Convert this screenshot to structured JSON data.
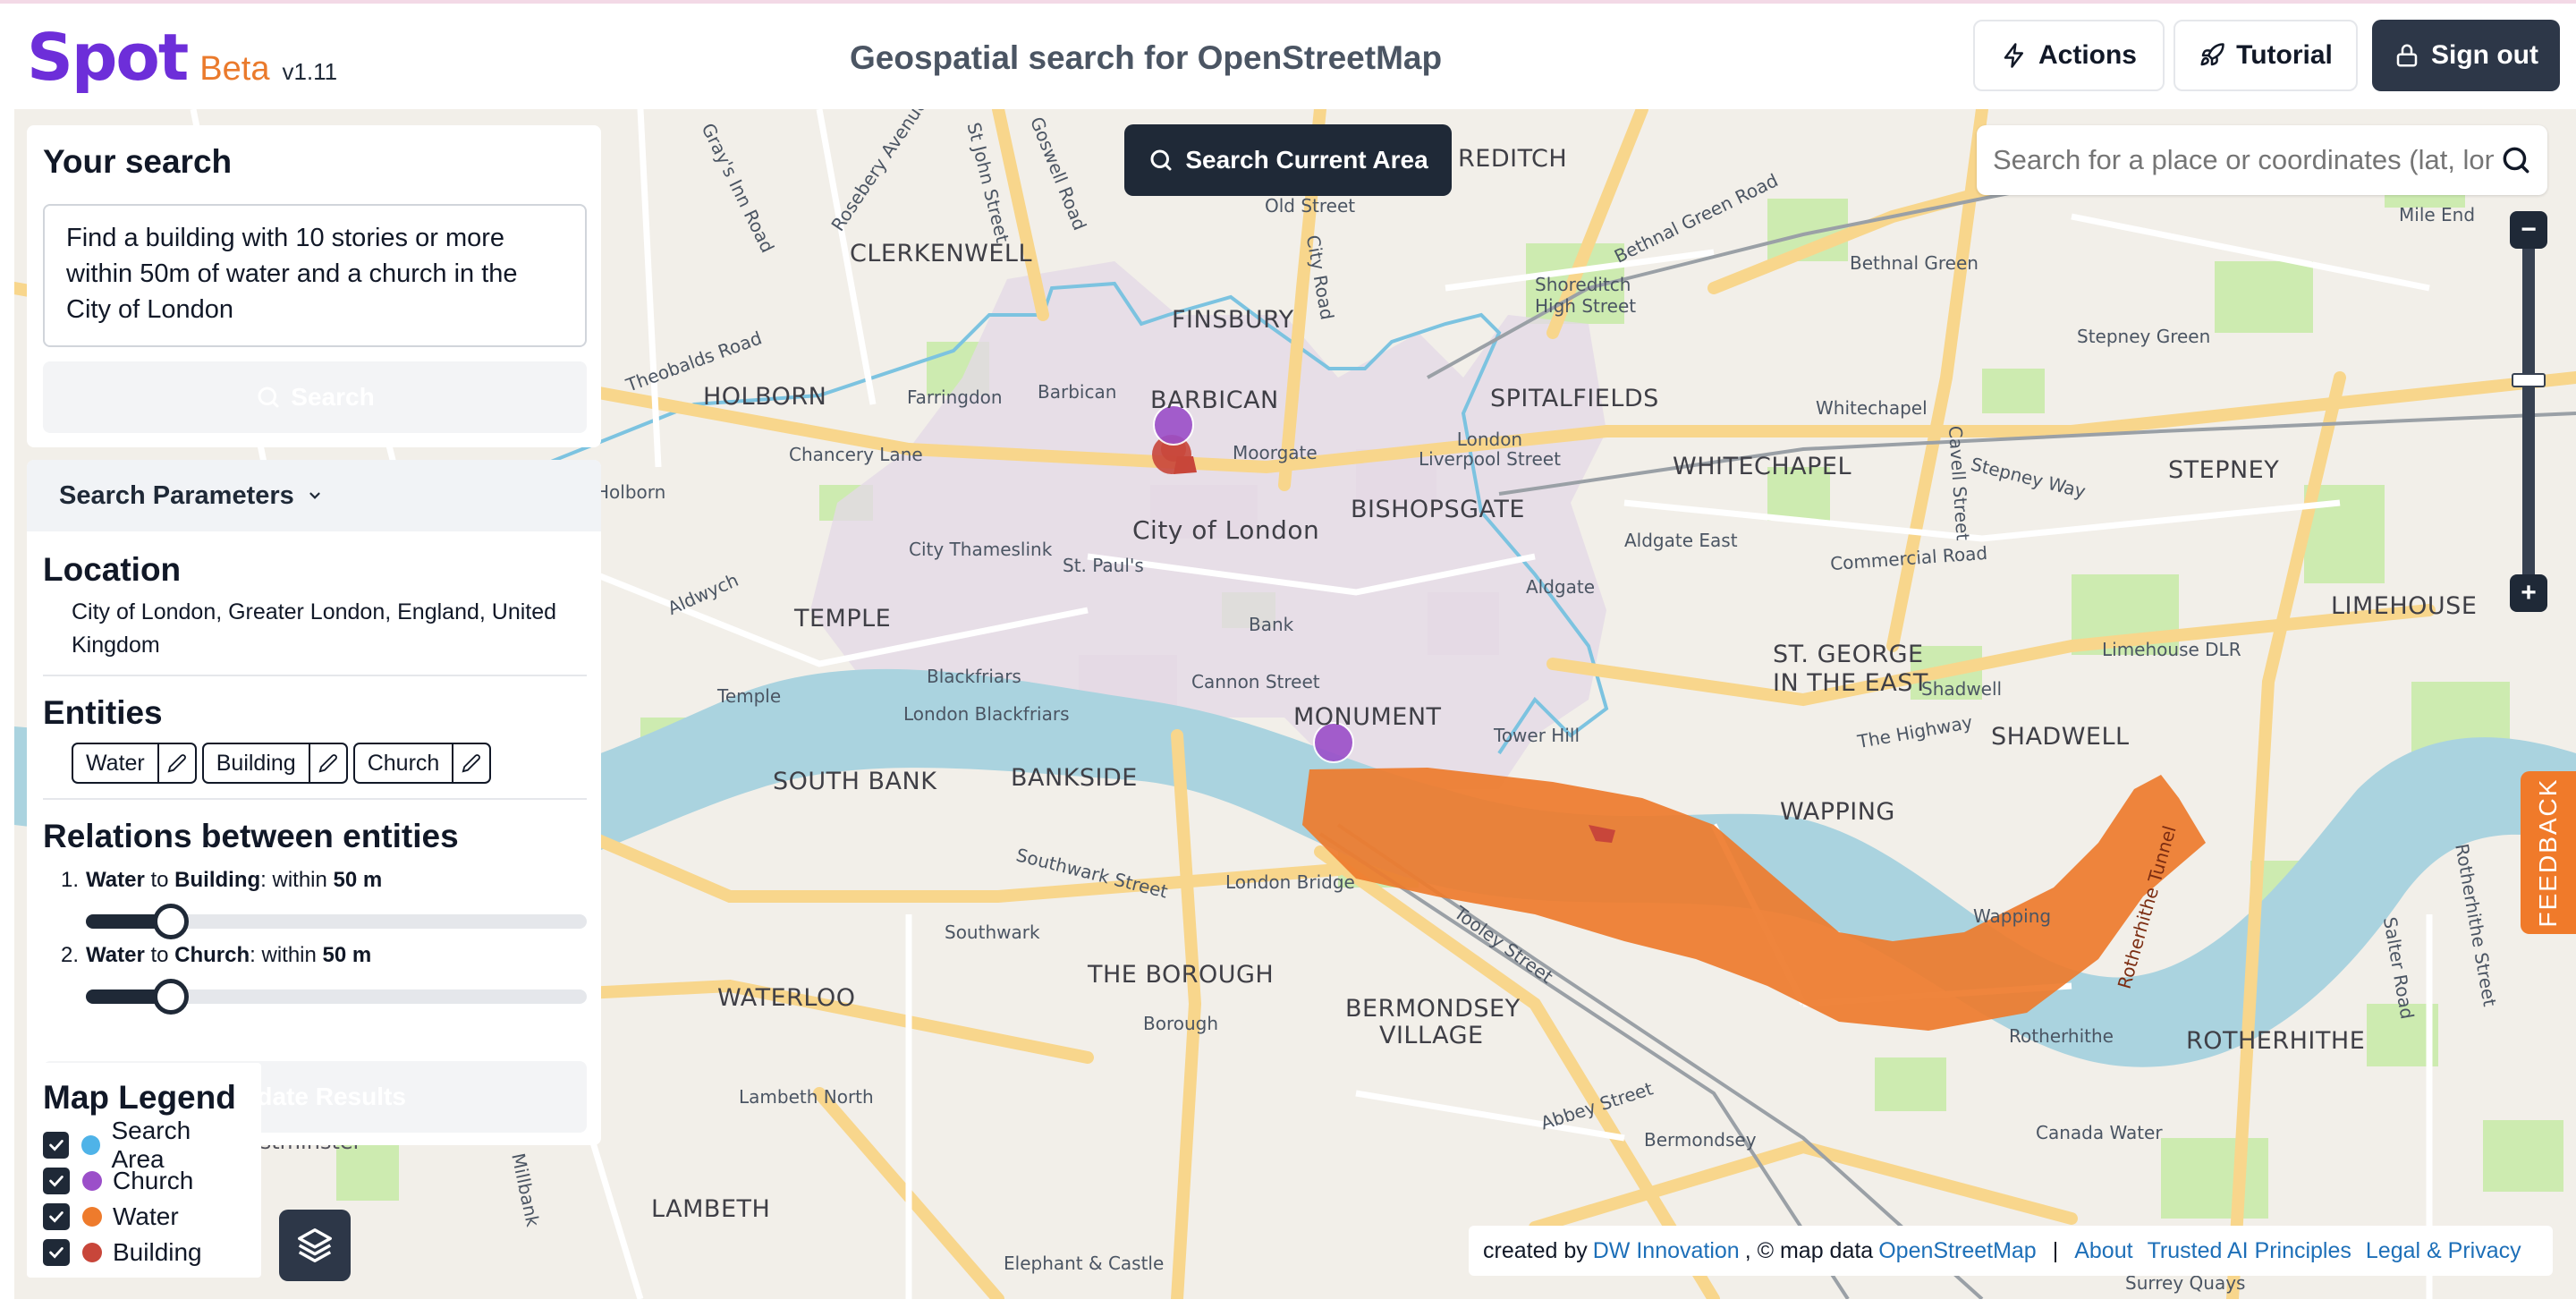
{
  "header": {
    "logo_text": "Spot",
    "beta_label": "Beta",
    "version": "v1.11",
    "title": "Geospatial search for OpenStreetMap",
    "actions_label": "Actions",
    "tutorial_label": "Tutorial",
    "signout_label": "Sign out"
  },
  "map": {
    "search_current_area_label": "Search Current Area",
    "place_search_placeholder": "Search for a place or coordinates (lat, lon)",
    "zoom_in": "+",
    "zoom_out": "−",
    "zoom_level_fraction": 0.6,
    "feedback_label": "FEEDBACK",
    "labels": {
      "clerkenwell": "CLERKENWELL",
      "finsbury": "FINSBURY",
      "holborn": "HOLBORN",
      "barbican": "BARBICAN",
      "spitalfields": "SPITALFIELDS",
      "whitechapel": "WHITECHAPEL",
      "stepney": "STEPNEY",
      "city_of_london": "City of London",
      "bishopsgate": "BISHOPSGATE",
      "temple": "TEMPLE",
      "limehouse": "LIMEHOUSE",
      "st_george_1": "ST. GEORGE",
      "st_george_2": "IN THE EAST",
      "monument": "MONUMENT",
      "shadwell": "SHADWELL",
      "south_bank": "SOUTH BANK",
      "bankside": "BANKSIDE",
      "wapping": "WAPPING",
      "waterloo": "WATERLOO",
      "the_borough": "THE BOROUGH",
      "bermondsey_1": "BERMONDSEY",
      "bermondsey_2": "VILLAGE",
      "rotherhithe": "ROTHERHITHE",
      "lambeth": "LAMBETH",
      "shoreditch": "REDITCH",
      "old_street": "Old Street",
      "bethnal_green": "Bethnal Green",
      "mile_end": "Mile End",
      "stepney_green": "Stepney Green",
      "farringdon": "Farringdon",
      "barbican_st": "Barbican",
      "moorgate": "Moorgate",
      "chancery_lane": "Chancery Lane",
      "holborn_st": "Holborn",
      "liverpool_st": "London\nLiverpool Street",
      "whitechapel_st": "Whitechapel",
      "aldgate_east": "Aldgate East",
      "aldgate": "Aldgate",
      "city_thameslink": "City Thameslink",
      "st_pauls": "St. Paul's",
      "bank": "Bank",
      "blackfriars": "Blackfriars",
      "cannon_street": "Cannon Street",
      "london_blackfriars": "London Blackfriars",
      "temple_st": "Temple",
      "tower_hill": "Tower Hill",
      "london_bridge": "London Bridge",
      "southwark": "Southwark",
      "borough": "Borough",
      "lambeth_north": "Lambeth North",
      "elephant_castle": "Elephant & Castle",
      "bermondsey_st": "Bermondsey",
      "rotherhithe_st": "Rotherhithe",
      "canada_water": "Canada Water",
      "surrey_quays": "Surrey Quays",
      "limehouse_dlr": "Limehouse DLR",
      "shadwell_st": "Shadwell",
      "wapping_st": "Wapping",
      "shoreditch_hs": "Shoreditch\nHigh Street",
      "commercial_road": "Commercial Road",
      "the_highway": "The Highway",
      "southwark_street": "Southwark Street",
      "tooley_street": "Tooley Street",
      "abbey_street": "Abbey Street",
      "stepney_way": "Stepney Way",
      "theobalds_road": "Theobalds Road",
      "aldwych": "Aldwych",
      "city_road": "City Road",
      "bethnal_green_road": "Bethnal Green Road",
      "goswell_road": "Goswell Road",
      "st_john_street": "St John Street",
      "rosebery_avenue": "Rosebery Avenue",
      "grays_inn_road": "Gray's Inn Road",
      "cavell_street": "Cavell Street",
      "salter_road": "Salter Road",
      "rotherhithe_street": "Rotherhithe Street",
      "rotherhithe_tunnel": "Rotherhithe Tunnel",
      "westminster": "estminster",
      "millbank": "Millbank"
    }
  },
  "panel": {
    "search_title": "Your search",
    "query": "Find a building with 10 stories or more within 50m of water and a church in the City of London",
    "search_button": "Search",
    "params_title": "Search Parameters",
    "location_title": "Location",
    "location_value": "City of London, Greater London, England, United Kingdom",
    "entities_title": "Entities",
    "entities": [
      "Water",
      "Building",
      "Church"
    ],
    "relations_title": "Relations between entities",
    "relations": [
      {
        "num": "1.",
        "from": "Water",
        "to": "Building",
        "prefix": "within",
        "distance": "50 m",
        "value_fraction": 0.17
      },
      {
        "num": "2.",
        "from": "Water",
        "to": "Church",
        "prefix": "within",
        "distance": "50 m",
        "value_fraction": 0.17
      }
    ],
    "update_button": "Update Results"
  },
  "legend": {
    "title": "Map Legend",
    "items": [
      {
        "label": "Search Area",
        "color": "#4fb3e8",
        "checked": true
      },
      {
        "label": "Church",
        "color": "#9b4fc9",
        "checked": true
      },
      {
        "label": "Water",
        "color": "#ee7b2c",
        "checked": true
      },
      {
        "label": "Building",
        "color": "#c8463a",
        "checked": true
      }
    ]
  },
  "attribution": {
    "created_by": "created by",
    "dw": "DW Innovation",
    "map_data": ", © map data",
    "osm": "OpenStreetMap",
    "divider": "|",
    "about": "About",
    "trusted_ai": "Trusted AI Principles",
    "legal": "Legal & Privacy"
  },
  "colors": {
    "brand": "#6d2ed9",
    "beta": "#ea7a2c",
    "dark_button": "#2d3748",
    "search_area": "#4fb3e8",
    "church": "#9b4fc9",
    "water_result": "#ee7b2c",
    "building": "#c8463a",
    "river": "#aad3df",
    "link": "#1d6fb8"
  }
}
